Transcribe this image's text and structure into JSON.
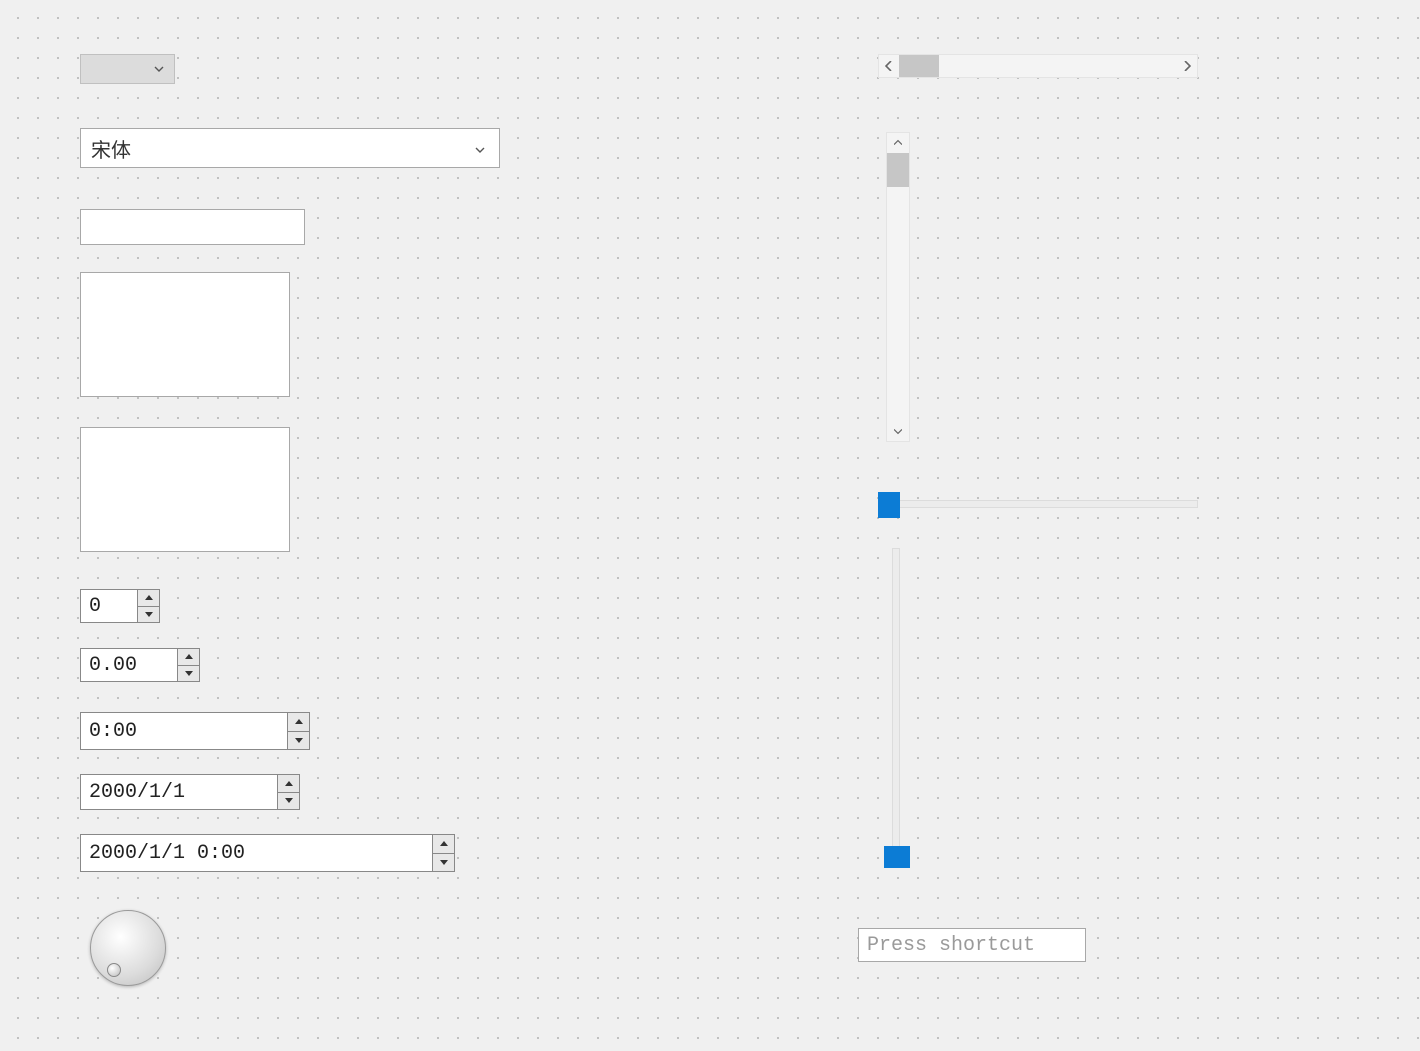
{
  "comboSmall": {
    "value": ""
  },
  "fontCombo": {
    "value": "宋体"
  },
  "lineEdit": {
    "value": ""
  },
  "textEdit1": {
    "value": ""
  },
  "textEdit2": {
    "value": ""
  },
  "spinInt": {
    "value": "0"
  },
  "spinDouble": {
    "value": "0.00"
  },
  "spinTime": {
    "value": "0:00"
  },
  "spinDate": {
    "value": "2000/1/1"
  },
  "spinDateTime": {
    "value": "2000/1/1 0:00"
  },
  "shortcut": {
    "placeholder": "Press shortcut"
  }
}
